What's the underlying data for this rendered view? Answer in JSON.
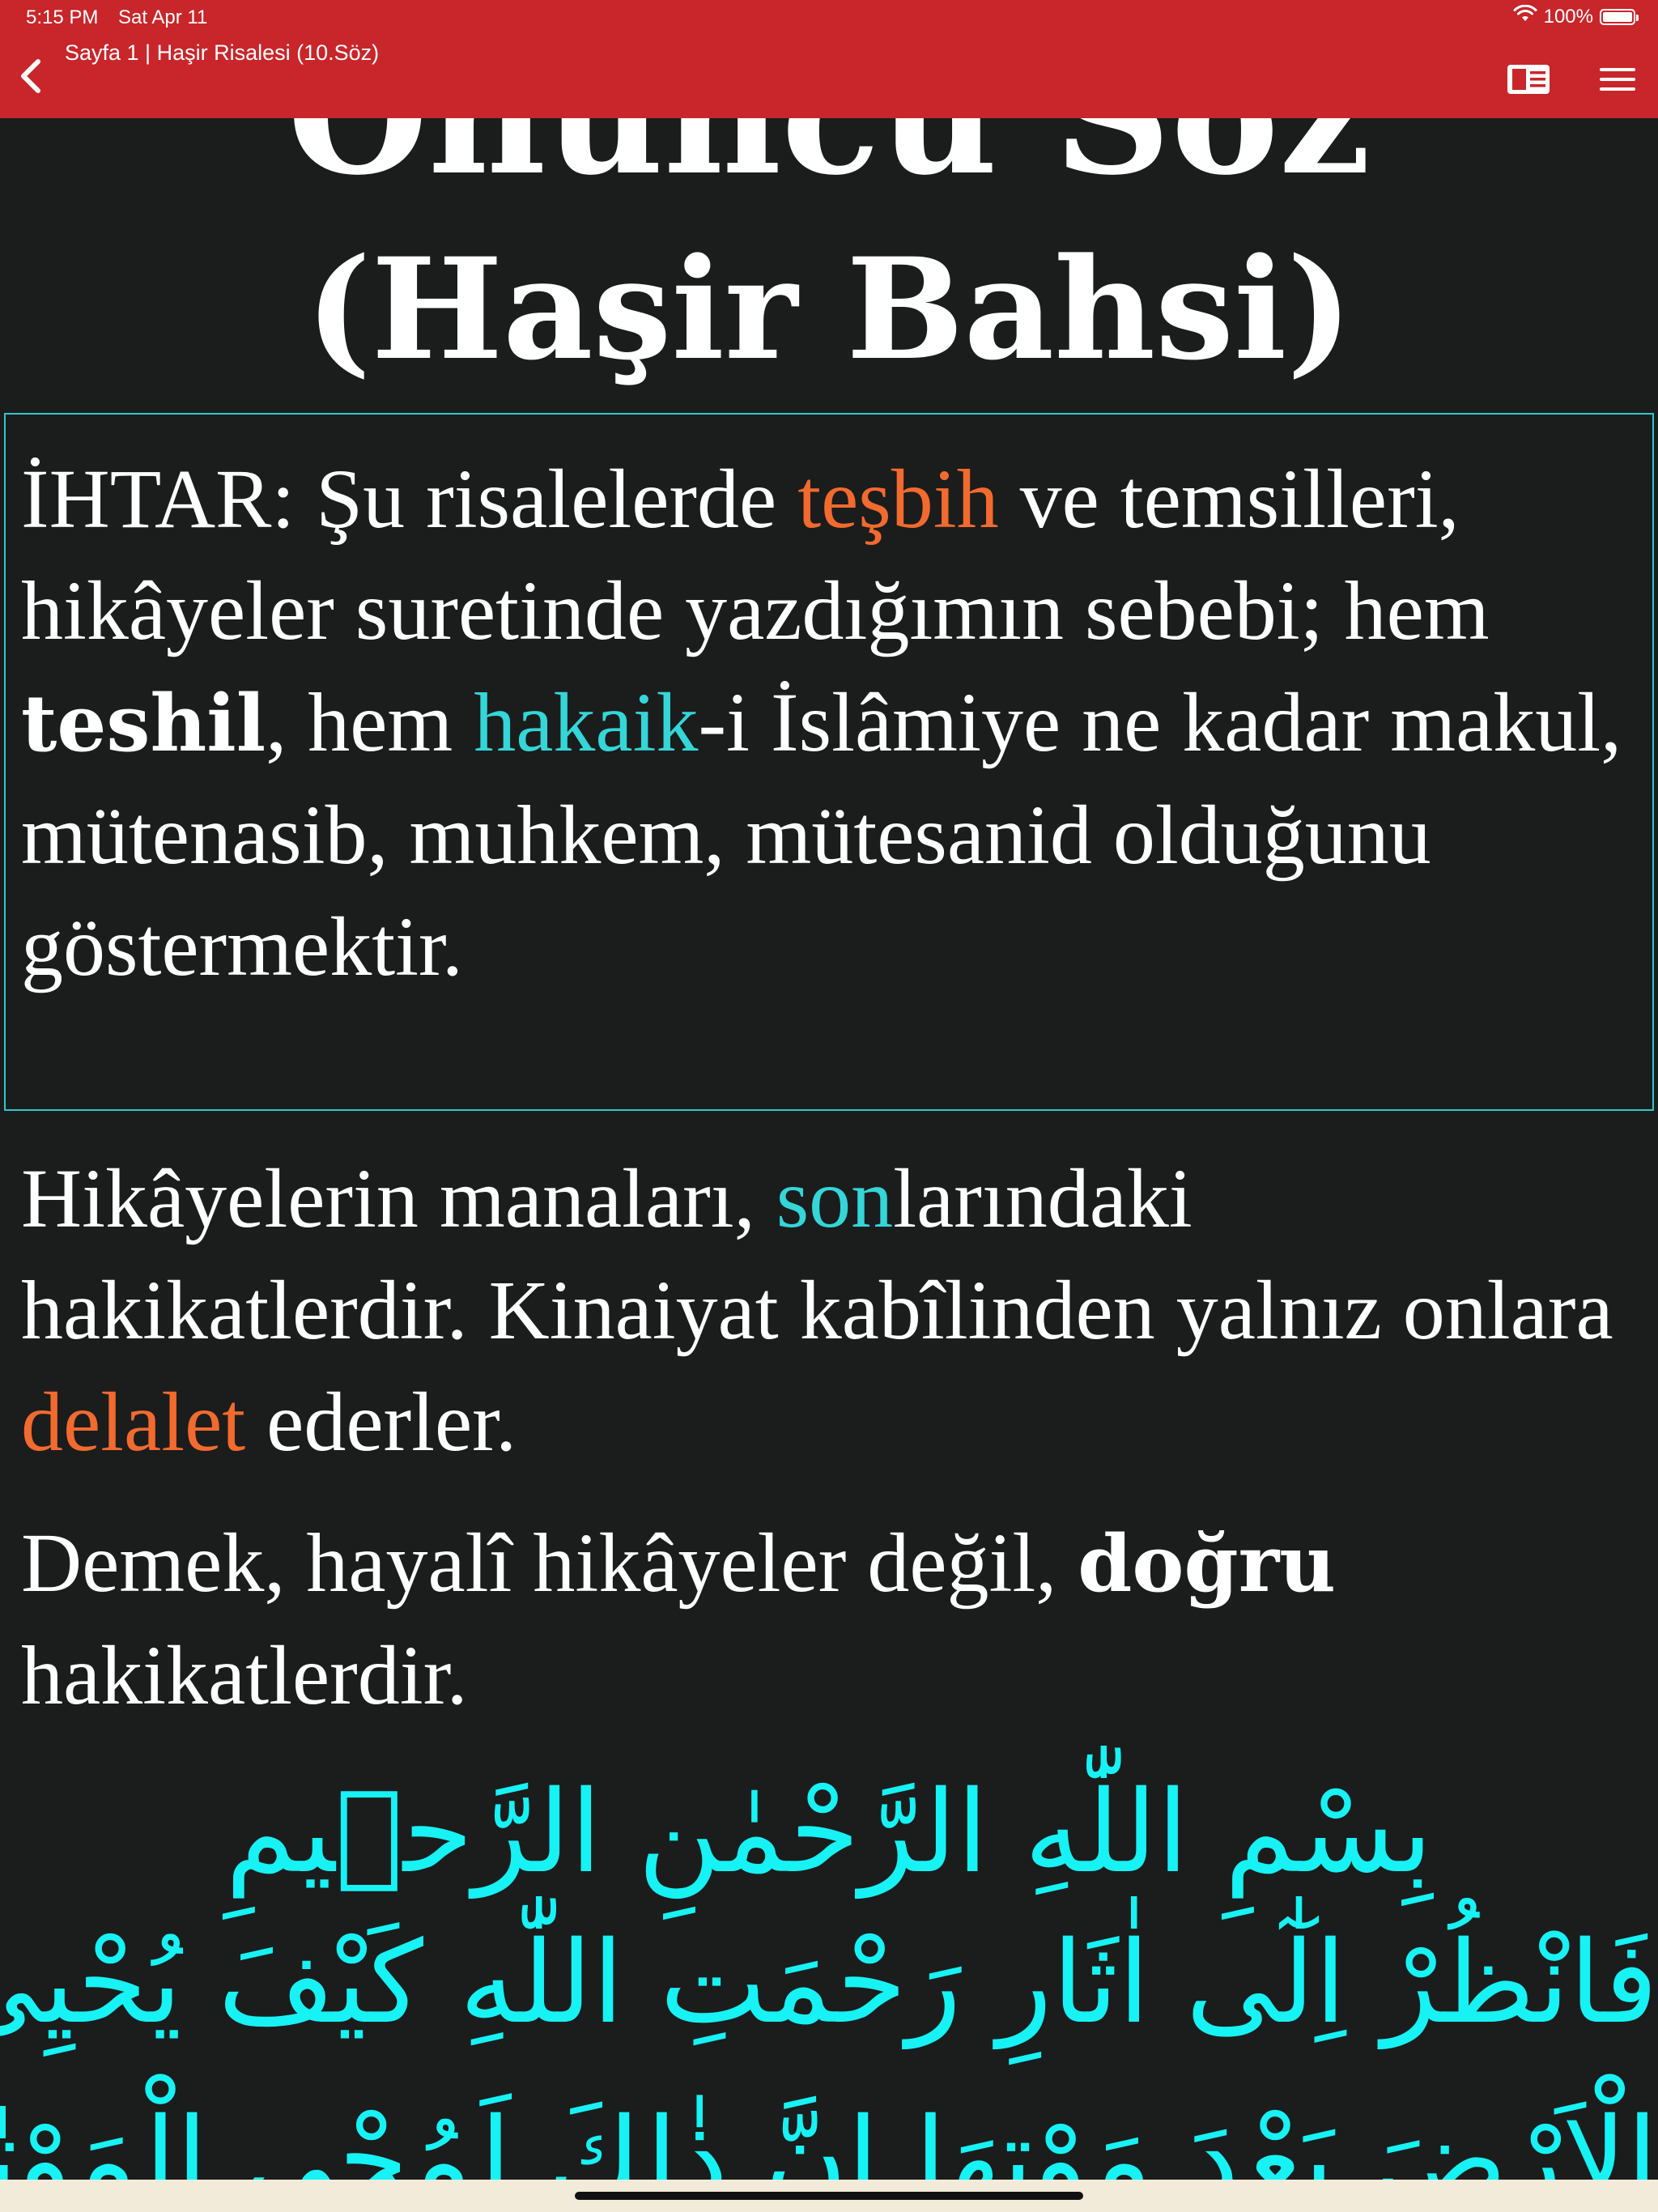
{
  "status_bar": {
    "time": "5:15 PM",
    "date": "Sat Apr 11",
    "battery": "100%",
    "battery_level": 1.0,
    "icons": [
      "wifi-icon",
      "battery-icon"
    ]
  },
  "nav": {
    "title": "Sayfa 1 | Haşir Risalesi (10.Söz)",
    "back_icon": "chevron-left-icon",
    "reader_icon": "reader-mode-icon",
    "menu_icon": "hamburger-menu-icon"
  },
  "colors": {
    "nav_bar": "#c8262a",
    "background": "#1b1c1c",
    "text": "#ffffff",
    "keyword_orange": "#f26a2e",
    "keyword_cyan": "#34d6d7",
    "arabic": "#17f2f4",
    "box_border": "#2fc7cf"
  },
  "content": {
    "title_line_1": "Onuncu Söz",
    "title_line_2": "(Haşir Bahsi)",
    "ihtar": {
      "t1": "İHTAR: Şu risalelerde ",
      "k1": "teşbih",
      "t2": " ve temsilleri, hikâyeler suretinde yazdığımın sebebi; hem ",
      "k2": "teshil",
      "t3": ", hem ",
      "k3": "hakaik",
      "t4": "-i İslâmiye ne kadar makul, mütenasib, muhkem, mütesanid olduğunu göstermektir."
    },
    "hikaye": {
      "t1": "Hikâyelerin manaları, ",
      "k1": "son",
      "t2": "larındaki hakikatlerdir. Kinaiyat kabîlinden yalnız onlara ",
      "k2": "delalet",
      "t3": " ederler."
    },
    "demek": {
      "t1": "Demek, hayalî hikâyeler değil, ",
      "k1": "doğru",
      "t2": " hakikatlerdir."
    },
    "arabic_line_1": "بِسْمِ اللّٰهِ الرَّحْمٰنِ الرَّح۪يمِ",
    "arabic_line_2": "فَانْظُرْ اِلٰٓى اٰثَارِ رَحْمَتِ اللّٰهِ كَيْفَ يُحْيِي",
    "arabic_line_3": "الْاَرْضَ بَعْدَ مَوْتِهَا اِنَّ ذٰلِكَ لَمُحْيِ الْمَوْتٰى"
  }
}
